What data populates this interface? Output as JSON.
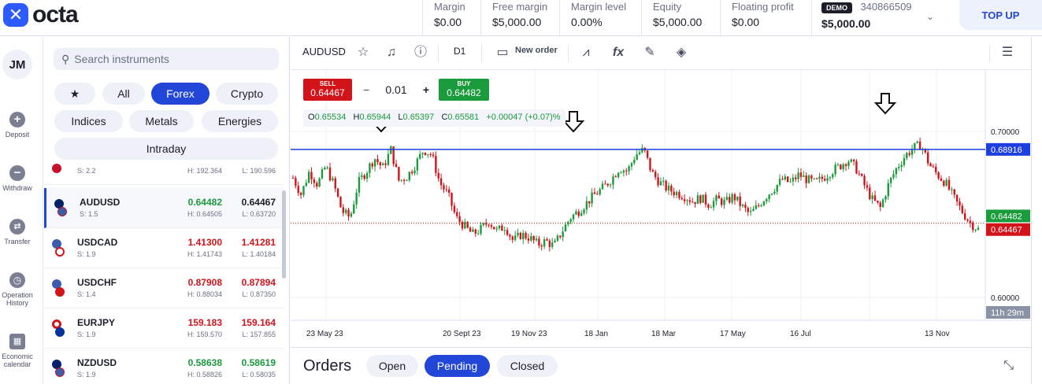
{
  "brand": {
    "name": "octa"
  },
  "metrics": [
    {
      "label": "Margin",
      "value": "$0.00"
    },
    {
      "label": "Free margin",
      "value": "$5,000.00"
    },
    {
      "label": "Margin level",
      "value": "0.00%"
    },
    {
      "label": "Equity",
      "value": "$5,000.00"
    },
    {
      "label": "Floating profit",
      "value": "$0.00"
    }
  ],
  "account": {
    "badge": "DEMO",
    "id": "340866509",
    "balance": "$5,000.00"
  },
  "topup": "TOP UP",
  "user": {
    "initials": "JM"
  },
  "nav": [
    {
      "label": "Deposit",
      "icon": "plus-icon"
    },
    {
      "label": "Withdraw",
      "icon": "minus-icon"
    },
    {
      "label": "Transfer",
      "icon": "transfer-icon"
    },
    {
      "label": "Operation History",
      "icon": "clock-icon"
    },
    {
      "label": "Economic calendar",
      "icon": "calendar-icon"
    }
  ],
  "search": {
    "placeholder": "Search instruments"
  },
  "filters": {
    "favorites_icon": "star-icon",
    "all": "All",
    "forex": "Forex",
    "crypto": "Crypto",
    "indices": "Indices",
    "metals": "Metals",
    "energies": "Energies",
    "intraday": "Intraday",
    "active": "Forex"
  },
  "instruments": [
    {
      "symbol": "",
      "spread": "S: 2.2",
      "bid": "",
      "ask": "",
      "high": "H: 192.364",
      "low": "L: 190.596",
      "bid_dir": "",
      "ask_dir": ""
    },
    {
      "symbol": "AUDUSD",
      "spread": "S: 1.5",
      "bid": "0.64482",
      "ask": "0.64467",
      "high": "H: 0.64505",
      "low": "L: 0.63720",
      "bid_dir": "up",
      "ask_dir": "blk"
    },
    {
      "symbol": "USDCAD",
      "spread": "S: 1.9",
      "bid": "1.41300",
      "ask": "1.41281",
      "high": "H: 1.41743",
      "low": "L: 1.40184",
      "bid_dir": "dn",
      "ask_dir": "dn"
    },
    {
      "symbol": "USDCHF",
      "spread": "S: 1.4",
      "bid": "0.87908",
      "ask": "0.87894",
      "high": "H: 0.88034",
      "low": "L: 0.87350",
      "bid_dir": "dn",
      "ask_dir": "dn"
    },
    {
      "symbol": "EURJPY",
      "spread": "S: 1.9",
      "bid": "159.183",
      "ask": "159.164",
      "high": "H: 159.570",
      "low": "L: 157.855",
      "bid_dir": "dn",
      "ask_dir": "dn"
    },
    {
      "symbol": "NZDUSD",
      "spread": "S: 1.9",
      "bid": "0.58638",
      "ask": "0.58619",
      "high": "H: 0.58826",
      "low": "L: 0.58035",
      "bid_dir": "up",
      "ask_dir": "up"
    }
  ],
  "toolbar": {
    "symbol": "AUDUSD",
    "timeframe": "D1",
    "new_order": "New order"
  },
  "trade": {
    "sell_label": "SELL",
    "sell_price": "0.64467",
    "buy_label": "BUY",
    "buy_price": "0.64482",
    "qty": "0.01",
    "minus": "−",
    "plus": "+"
  },
  "ohlc": {
    "o_label": "O",
    "o": "0.65534",
    "h_label": "H",
    "h": "0.65944",
    "l_label": "L",
    "l": "0.65397",
    "c_label": "C",
    "c": "0.65581",
    "change": "+0.00047 (+0.07)%"
  },
  "price_axis": {
    "ticks": [
      "0.70000",
      "0.60000"
    ],
    "hline_label": "0.68916",
    "buy_label": "0.64482",
    "sell_label": "0.64467",
    "countdown": "11h 29m"
  },
  "time_axis": [
    "23 May 23",
    "20 Sept 23",
    "19 Nov 23",
    "18 Jan",
    "18 Mar",
    "17 May",
    "16 Jul",
    "13 Nov"
  ],
  "colors": {
    "accent": "#2246d8",
    "up": "#1a9b3c",
    "down": "#d3131a",
    "hline": "#1e3fe0"
  },
  "chart_data": {
    "type": "candlestick",
    "ylim": [
      0.6,
      0.7
    ],
    "horizontal_line": 0.68916,
    "bid_line": 0.64482,
    "ask_line": 0.64467,
    "annotations": [
      "down-arrow",
      "down-arrow",
      "down-arrow"
    ],
    "close_path": [
      0.672,
      0.662,
      0.676,
      0.668,
      0.679,
      0.668,
      0.652,
      0.648,
      0.669,
      0.676,
      0.684,
      0.678,
      0.689,
      0.67,
      0.673,
      0.68,
      0.689,
      0.686,
      0.669,
      0.662,
      0.648,
      0.643,
      0.638,
      0.641,
      0.646,
      0.64,
      0.643,
      0.634,
      0.638,
      0.636,
      0.632,
      0.634,
      0.631,
      0.64,
      0.648,
      0.652,
      0.657,
      0.662,
      0.666,
      0.671,
      0.678,
      0.676,
      0.686,
      0.689,
      0.675,
      0.669,
      0.665,
      0.663,
      0.661,
      0.658,
      0.66,
      0.656,
      0.659,
      0.657,
      0.661,
      0.655,
      0.65,
      0.655,
      0.661,
      0.666,
      0.671,
      0.669,
      0.674,
      0.671,
      0.669,
      0.672,
      0.676,
      0.679,
      0.683,
      0.678,
      0.668,
      0.659,
      0.654,
      0.668,
      0.678,
      0.685,
      0.69,
      0.692,
      0.68,
      0.674,
      0.669,
      0.66,
      0.652,
      0.645,
      0.641
    ]
  }
}
